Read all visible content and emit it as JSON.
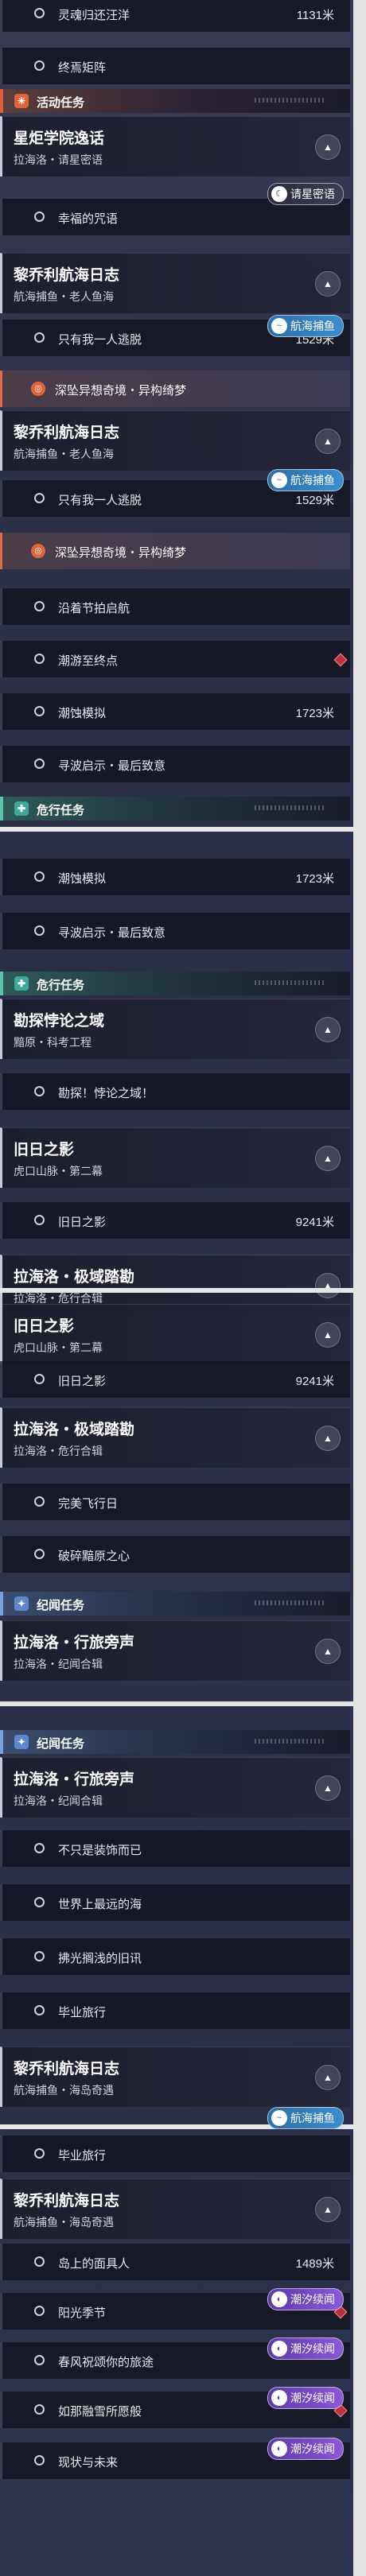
{
  "colors": {
    "activity": "#e05e3c",
    "danger": "#5ec4b0",
    "legend": "#7aa0e0",
    "sea_badge": "#3c8ed0",
    "tide_badge": "#8a5ad8"
  },
  "icons": {
    "objective": "circle-icon",
    "collapse": "chevron-up-icon",
    "activity_section": "activity-icon",
    "danger_section": "danger-icon",
    "legend_section": "legend-star-icon",
    "dream": "swirl-icon",
    "marker": "diamond-marker-icon"
  },
  "sections": {
    "activity": "活动任务",
    "danger": "危行任务",
    "legend": "纪闻任务"
  },
  "quests": {
    "stellar_title": "星炬学院逸话",
    "stellar_sub": "拉海洛・请星密语",
    "liqiao_title": "黎乔利航海日志",
    "liqiao_sub_old": "航海捕鱼・老人鱼海",
    "liqiao_sub_island": "航海捕鱼・海岛奇遇",
    "truth_title": "勘探悖论之域",
    "truth_sub": "黯原・科考工程",
    "shadow_title": "旧日之影",
    "shadow_sub": "虎口山脉・第二幕",
    "polar_title": "拉海洛・极域踏勘",
    "polar_sub": "拉海洛・危行合辑",
    "travel_title": "拉海洛・行旅旁声",
    "travel_sub": "拉海洛・纪闻合辑"
  },
  "objectives": {
    "soul_return": "灵魂归还汪洋",
    "soul_return_dist": "1131米",
    "final_array": "终焉矩阵",
    "blessing_spell": "幸福的咒语",
    "only_me": "只有我一人逃脱",
    "only_me_dist": "1529米",
    "abyss_dream": "深坠异想奇境・异构绮梦",
    "seasonal_sail": "沿着节拍启航",
    "tide_end": "潮游至终点",
    "erosion_sim": "潮蚀模拟",
    "erosion_sim_dist": "1723米",
    "wave_search": "寻波启示・最后致意",
    "truth_obj": "勘探！悖论之域！",
    "shadow_obj": "旧日之影",
    "shadow_obj_dist": "9241米",
    "perfect_flight": "完美飞行日",
    "broken_heart": "破碎黯原之心",
    "not_decor": "不只是装饰而已",
    "farthest_sea": "世界上最远的海",
    "old_traces": "拂光搁浅的旧讯",
    "graduation": "毕业旅行",
    "island_face": "岛上的面具人",
    "island_face_dist": "1489米",
    "sunlit_season": "阳光季节",
    "spring_breeze": "春风祝颂你的旅途",
    "truce_scroll": "如那融雪所愿般",
    "now_future": "现状与未来"
  },
  "badges": {
    "stellar": "请星密语",
    "sea": "航海捕鱼",
    "tide": "潮汐续闻"
  }
}
